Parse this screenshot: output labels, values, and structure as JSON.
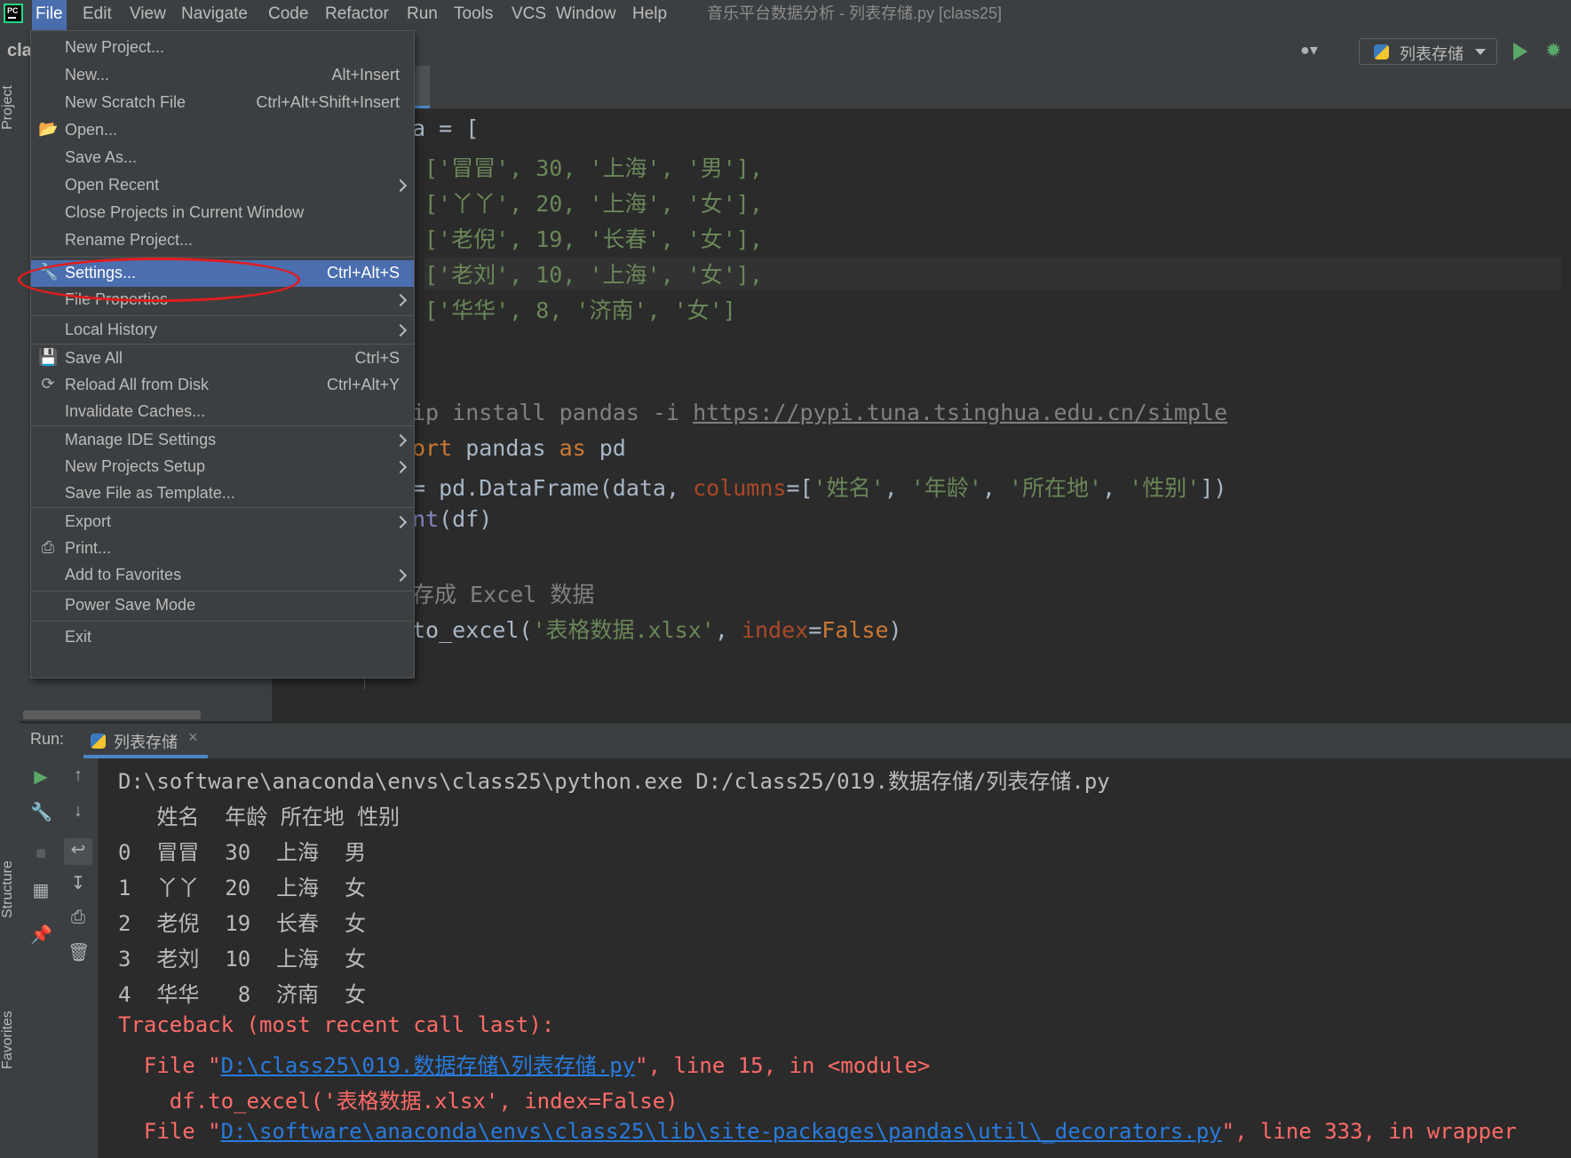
{
  "window_title": "音乐平台数据分析 - 列表存储.py [class25]",
  "menubar": {
    "logo": "PC",
    "items": [
      {
        "label": "File"
      },
      {
        "label": "Edit"
      },
      {
        "label": "View"
      },
      {
        "label": "Navigate"
      },
      {
        "label": "Code"
      },
      {
        "label": "Refactor"
      },
      {
        "label": "Run"
      },
      {
        "label": "Tools"
      },
      {
        "label": "VCS"
      },
      {
        "label": "Window"
      },
      {
        "label": "Help"
      }
    ]
  },
  "toolbar": {
    "project_hint": "cla",
    "run_config": "列表存储"
  },
  "side_tabs": {
    "project": "Project",
    "structure": "Structure",
    "favorites": "Favorites"
  },
  "file_menu": {
    "items": [
      {
        "label": "New Project...",
        "shortcut": ""
      },
      {
        "label": "New...",
        "shortcut": "Alt+Insert"
      },
      {
        "label": "New Scratch File",
        "shortcut": "Ctrl+Alt+Shift+Insert"
      },
      {
        "label": "Open...",
        "shortcut": "",
        "icon": "folder-open-icon"
      },
      {
        "label": "Save As...",
        "shortcut": ""
      },
      {
        "label": "Open Recent",
        "submenu": true
      },
      {
        "label": "Close Projects in Current Window",
        "shortcut": ""
      },
      {
        "label": "Rename Project...",
        "shortcut": ""
      },
      {
        "label": "Settings...",
        "shortcut": "Ctrl+Alt+S",
        "icon": "wrench-icon",
        "selected": true
      },
      {
        "label": "File Properties",
        "submenu": true
      },
      {
        "label": "Local History",
        "submenu": true
      },
      {
        "label": "Save All",
        "shortcut": "Ctrl+S",
        "icon": "save-icon"
      },
      {
        "label": "Reload All from Disk",
        "shortcut": "Ctrl+Alt+Y",
        "icon": "reload-icon"
      },
      {
        "label": "Invalidate Caches...",
        "shortcut": ""
      },
      {
        "label": "Manage IDE Settings",
        "submenu": true
      },
      {
        "label": "New Projects Setup",
        "submenu": true
      },
      {
        "label": "Save File as Template...",
        "shortcut": ""
      },
      {
        "label": "Export",
        "submenu": true
      },
      {
        "label": "Print...",
        "shortcut": "",
        "icon": "print-icon"
      },
      {
        "label": "Add to Favorites",
        "submenu": true
      },
      {
        "label": "Power Save Mode",
        "shortcut": ""
      },
      {
        "label": "Exit",
        "shortcut": ""
      }
    ]
  },
  "editor": {
    "lines": [
      "a = [",
      "['冒冒', 30, '上海', '男'],",
      "['丫丫', 20, '上海', '女'],",
      "['老倪', 19, '长春', '女'],",
      "['老刘', 10, '上海', '女'],",
      "['华华', 8, '济南', '女']",
      "ip install pandas -i ",
      "https://pypi.tuna.tsinghua.edu.cn/simple",
      "ort",
      " pandas ",
      "as",
      " pd",
      "= pd.DataFrame(data, ",
      "columns",
      "=[",
      "'姓名'",
      ", ",
      "'年龄'",
      "'所在地'",
      "'性别'",
      "])",
      "nt",
      "(df)",
      "存成 Excel 数据",
      "to_excel(",
      "'表格数据.xlsx'",
      "index",
      "=",
      "False",
      ")"
    ]
  },
  "run_panel": {
    "title": "Run:",
    "tab": "列表存储",
    "console": [
      "D:\\software\\anaconda\\envs\\class25\\python.exe D:/class25/019.数据存储/列表存储.py",
      "   姓名  年龄 所在地 性别",
      "0  冒冒  30  上海  男",
      "1  丫丫  20  上海  女",
      "2  老倪  19  长春  女",
      "3  老刘  10  上海  女",
      "4  华华   8  济南  女",
      "Traceback (most recent call last):",
      "  File \"",
      "D:\\class25\\019.数据存储\\列表存储.py",
      "\", line 15, in <module>",
      "    df.to_excel('表格数据.xlsx', index=False)",
      "D:\\software\\anaconda\\envs\\class25\\lib\\site-packages\\pandas\\util\\_decorators.py",
      "\", line 333, in wrapper"
    ]
  }
}
